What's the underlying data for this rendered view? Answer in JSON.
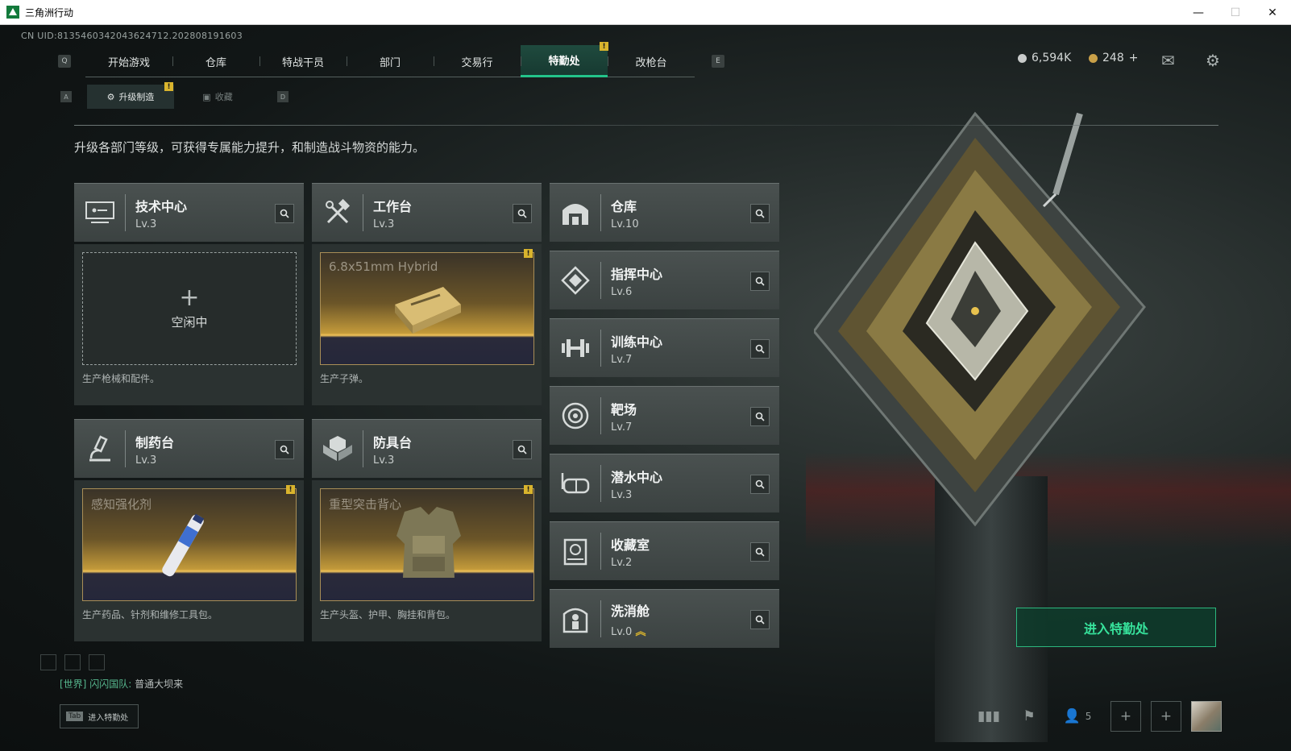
{
  "window": {
    "title": "三角洲行动",
    "min": "—",
    "max": "☐",
    "close": "✕"
  },
  "uid": "CN UID:8135460342043624712.202808191603",
  "nav": {
    "left_key": "Q",
    "right_key": "E",
    "tabs": [
      {
        "label": "开始游戏"
      },
      {
        "label": "仓库"
      },
      {
        "label": "特战干员"
      },
      {
        "label": "部门"
      },
      {
        "label": "交易行"
      },
      {
        "label": "特勤处",
        "active": true,
        "alert": "!"
      },
      {
        "label": "改枪台"
      }
    ]
  },
  "subnav": {
    "left_key": "A",
    "right_key": "D",
    "tabs": [
      {
        "label": "升级制造",
        "active": true,
        "alert": "!"
      },
      {
        "label": "收藏"
      }
    ]
  },
  "currency": {
    "silver": "6,594K",
    "gold": "248",
    "gold_add": "+"
  },
  "description": "升级各部门等级，可获得专属能力提升，和制造战斗物资的能力。",
  "facilities_left": [
    {
      "name": "技术中心",
      "level": "Lv.3",
      "icon": "monitor-icon",
      "slot": {
        "state": "idle",
        "plus": "+",
        "status": "空闲中"
      },
      "desc": "生产枪械和配件。"
    },
    {
      "name": "工作台",
      "level": "Lv.3",
      "icon": "tools-icon",
      "slot": {
        "state": "item",
        "item": "6.8x51mm Hybrid",
        "alert": "!"
      },
      "desc": "生产子弹。"
    },
    {
      "name": "制药台",
      "level": "Lv.3",
      "icon": "microscope-icon",
      "slot": {
        "state": "item",
        "item": "感知强化剂",
        "alert": "!"
      },
      "desc": "生产药品、针剂和维修工具包。"
    },
    {
      "name": "防具台",
      "level": "Lv.3",
      "icon": "cubes-icon",
      "slot": {
        "state": "item",
        "item": "重型突击背心",
        "alert": "!"
      },
      "desc": "生产头盔、护甲、胸挂和背包。"
    }
  ],
  "facilities_right": [
    {
      "name": "仓库",
      "level": "Lv.10",
      "icon": "warehouse-icon"
    },
    {
      "name": "指挥中心",
      "level": "Lv.6",
      "icon": "command-icon"
    },
    {
      "name": "训练中心",
      "level": "Lv.7",
      "icon": "dumbbell-icon"
    },
    {
      "name": "靶场",
      "level": "Lv.7",
      "icon": "target-icon"
    },
    {
      "name": "潜水中心",
      "level": "Lv.3",
      "icon": "goggles-icon"
    },
    {
      "name": "收藏室",
      "level": "Lv.2",
      "icon": "collection-icon"
    },
    {
      "name": "洗消舱",
      "level": "Lv.0",
      "icon": "decon-icon",
      "upgrade_arrow": "︽"
    }
  ],
  "enter_button": "进入特勤处",
  "chat": {
    "channel": "[世界]",
    "sender": "闪闪国队:",
    "message": "普通大坝来"
  },
  "tab_hint": {
    "key": "Tab",
    "label": "进入特勤处"
  },
  "bottom": {
    "friends_count": "5"
  },
  "colors": {
    "accent": "#23c48a",
    "alert": "#d9b42d",
    "item_gold": "#f2c45a"
  }
}
